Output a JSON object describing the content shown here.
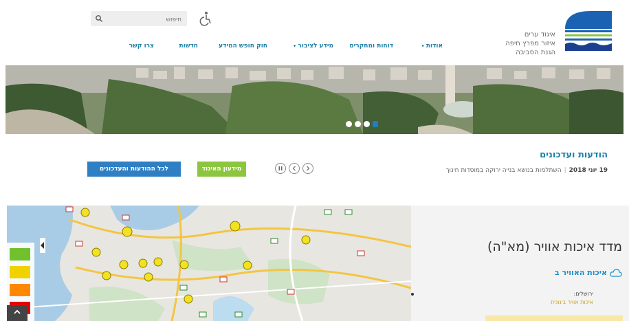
{
  "header": {
    "logo_lines": [
      "איגוד ערים",
      "איזור מפרץ חיפה",
      "הגנת הסביבה"
    ],
    "search": {
      "placeholder": "חיפוש"
    },
    "nav": [
      {
        "label": "אודות",
        "dropdown": true
      },
      {
        "label": "דוחות ומחקרים",
        "dropdown": false
      },
      {
        "label": "מידע לציבור",
        "dropdown": true
      },
      {
        "label": "חוק חופש המידע",
        "dropdown": false
      },
      {
        "label": "חדשות",
        "dropdown": false
      },
      {
        "label": "צרו קשר",
        "dropdown": false
      }
    ]
  },
  "hero": {
    "slides": 4,
    "active_slide": 1
  },
  "news": {
    "title": "הודעות ועדכונים",
    "date": "19 יוני 2018",
    "headline": "השתלמות בנושא בנייה ירוקה במוסדות חינוך",
    "btn_info": "מידעון האיגוד",
    "btn_all": "לכל ההודעות והעדכונים"
  },
  "aqi": {
    "title": "מדד איכות אוויר (מא\"ה)",
    "subtitle": "איכות האוויר ב",
    "city": "ירושלים:",
    "status": "איכות אוויר בינונית"
  },
  "legend": {
    "colors": [
      "#72c02c",
      "#f0d200",
      "#ff8800",
      "#e50000"
    ]
  },
  "colors": {
    "brand_blue": "#1b7fa6",
    "button_blue": "#2f7fc4",
    "button_green": "#8cc63f"
  }
}
